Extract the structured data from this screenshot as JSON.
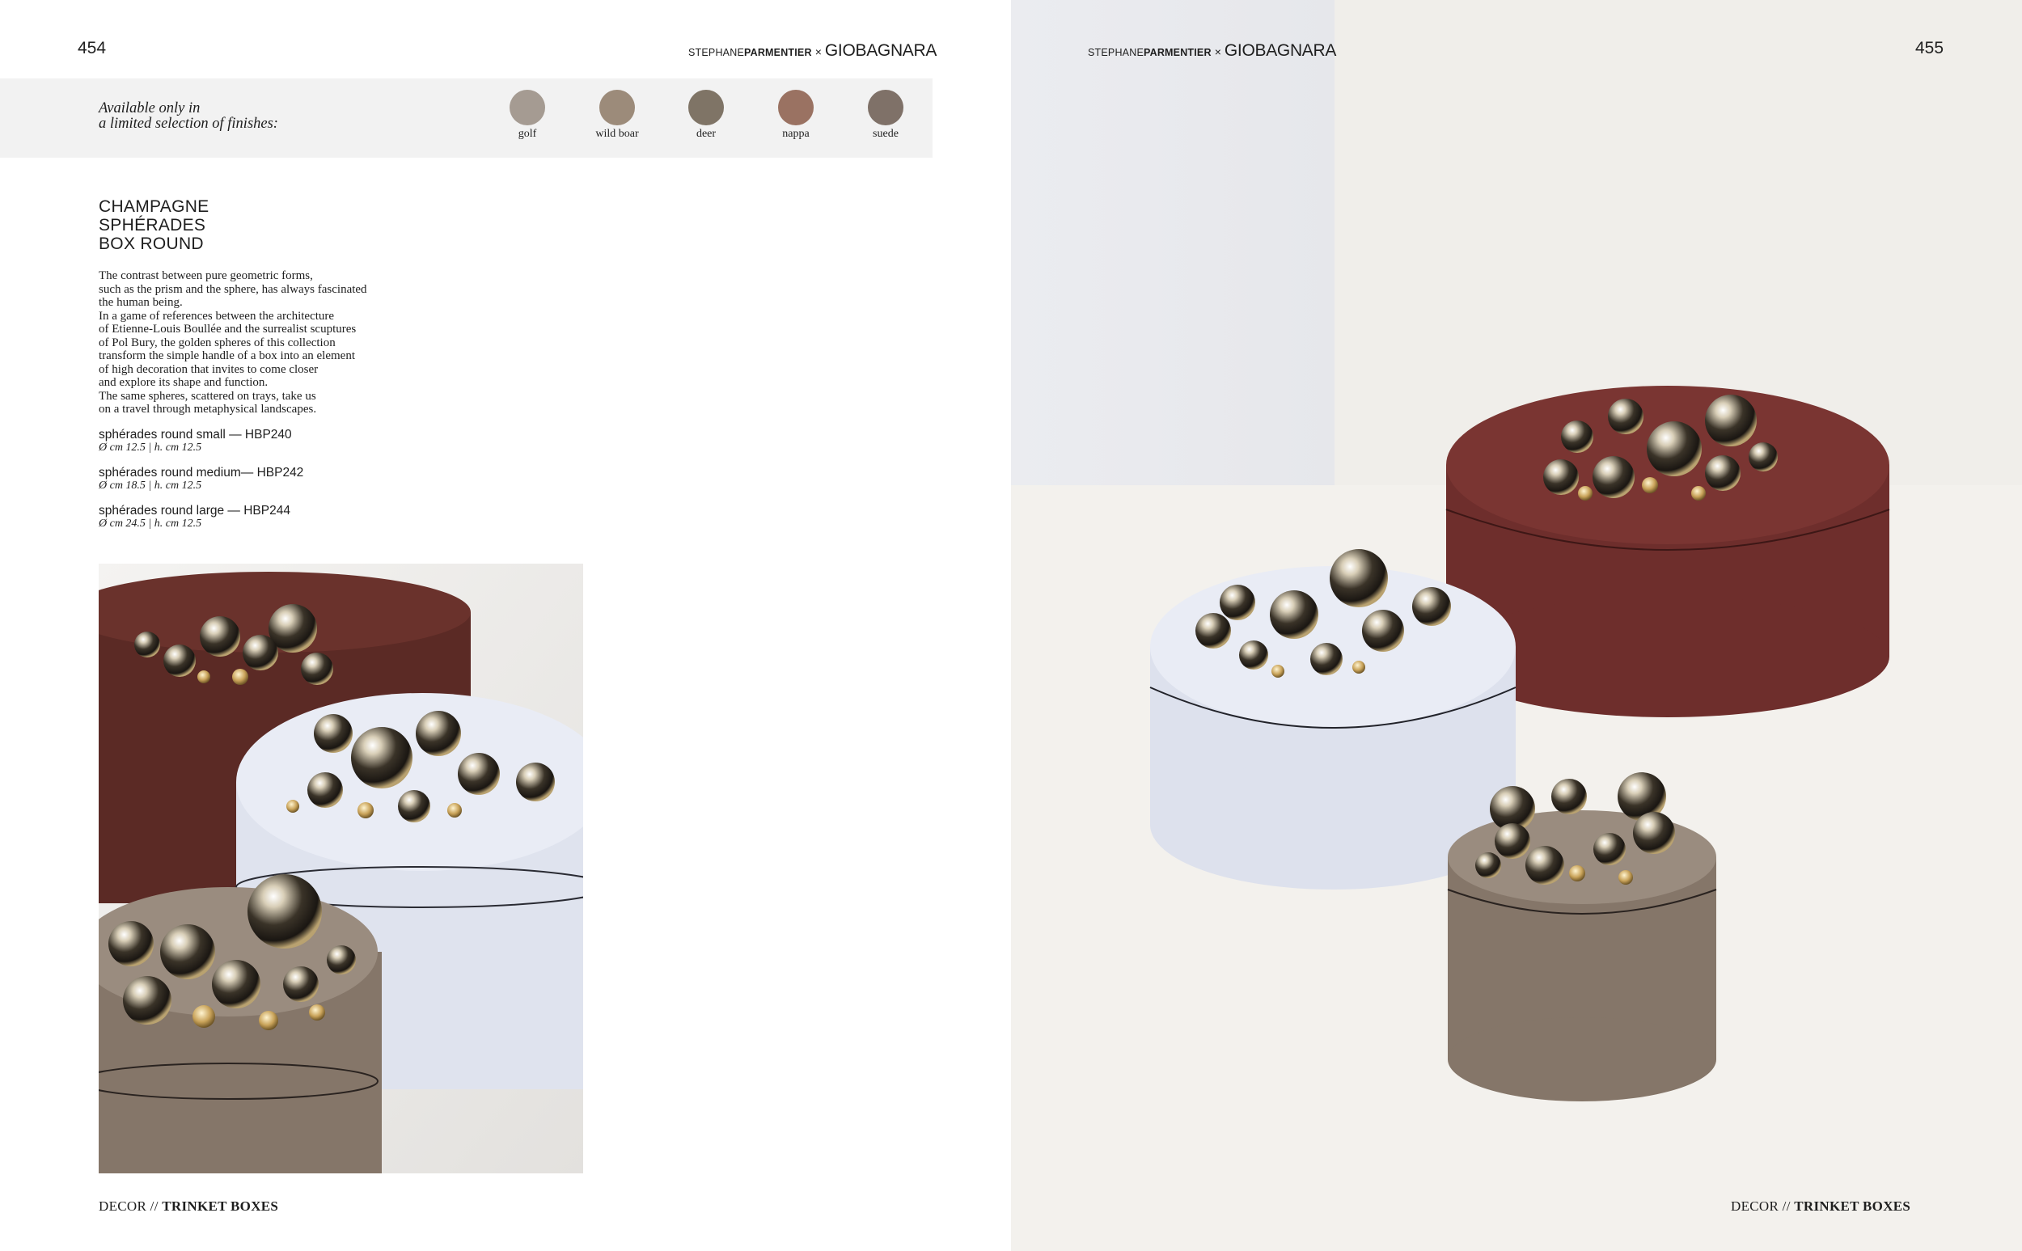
{
  "left_page": {
    "page_number": "454",
    "brand": {
      "part1": "STEPHANE",
      "part2": "PARMENTIER",
      "separator": "×",
      "part3": "GIOBAGNARA"
    },
    "finishes": {
      "label_line1": "Available only in",
      "label_line2": "a limited selection of finishes:",
      "items": [
        {
          "name": "golf",
          "color": "#a59b92"
        },
        {
          "name": "wild boar",
          "color": "#9c8b7a"
        },
        {
          "name": "deer",
          "color": "#7f7466"
        },
        {
          "name": "nappa",
          "color": "#9a7262"
        },
        {
          "name": "suede",
          "color": "#7f7168"
        }
      ]
    },
    "title": [
      "CHAMPAGNE",
      "SPHÉRADES",
      "BOX ROUND"
    ],
    "description": [
      "The contrast between pure geometric forms,",
      "such as the prism and the sphere, has always fascinated",
      "the human being.",
      "In a game of references between the architecture",
      "of Etienne-Louis Boullée and the surrealist scuptures",
      "of Pol Bury, the golden spheres of this collection",
      "transform the simple handle of a box into an element",
      "of high decoration that invites to come closer",
      "and explore its shape and function.",
      "The same spheres, scattered on trays, take us",
      "on a travel through metaphysical landscapes."
    ],
    "variants": [
      {
        "name": "sphérades round small — HBP240",
        "dims": "Ø cm 12.5 | h. cm 12.5"
      },
      {
        "name": "sphérades round  medium— HBP242",
        "dims": "Ø cm 18.5 | h. cm 12.5"
      },
      {
        "name": "sphérades round large — HBP244",
        "dims": "Ø cm 24.5 | h. cm 12.5"
      }
    ],
    "footer": {
      "section": "DECOR //",
      "category": "TRINKET BOXES"
    }
  },
  "right_page": {
    "page_number": "455",
    "brand": {
      "part1": "STEPHANE",
      "part2": "PARMENTIER",
      "separator": "×",
      "part3": "GIOBAGNARA"
    },
    "footer": {
      "section": "DECOR //",
      "category": "TRINKET BOXES"
    }
  },
  "colors": {
    "burgundy_box": "#6e2e2c",
    "lightblue_box": "#dfe3ef",
    "taupe_box": "#857669",
    "brown_box": "#5a2a24"
  }
}
